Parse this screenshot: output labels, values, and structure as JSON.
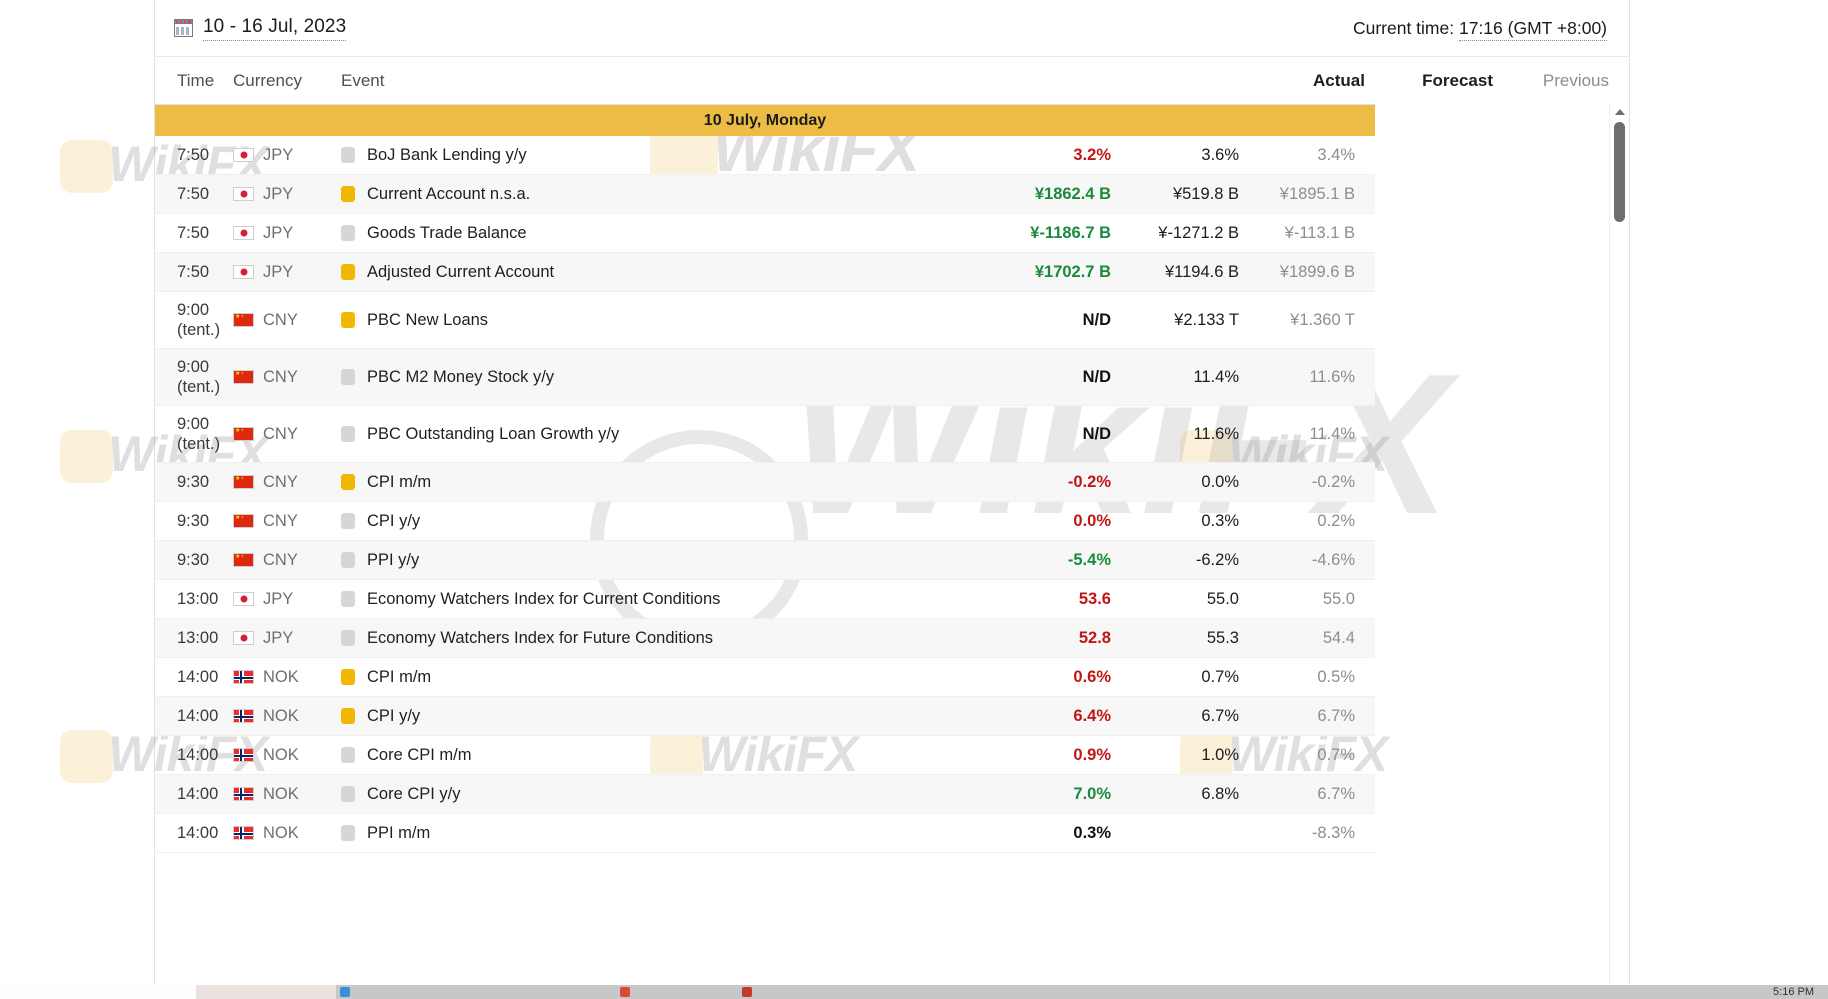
{
  "toolbar": {
    "calendar_icon": "calendar-icon",
    "date_range": "10 - 16 Jul, 2023",
    "current_time_label": "Current time:",
    "current_time_value": "17:16 (GMT +8:00)"
  },
  "columns": {
    "time": "Time",
    "currency": "Currency",
    "event": "Event",
    "actual": "Actual",
    "forecast": "Forecast",
    "previous": "Previous"
  },
  "day_header": "10 July, Monday",
  "rows": [
    {
      "time": "7:50",
      "tentative": "",
      "flag": "jp",
      "currency": "JPY",
      "impact": "low",
      "event": "BoJ Bank Lending y/y",
      "actual": "3.2%",
      "actual_color": "red",
      "forecast": "3.6%",
      "previous": "3.4%"
    },
    {
      "time": "7:50",
      "tentative": "",
      "flag": "jp",
      "currency": "JPY",
      "impact": "med",
      "event": "Current Account n.s.a.",
      "actual": "¥1862.4 B",
      "actual_color": "green",
      "forecast": "¥519.8 B",
      "previous": "¥1895.1 B"
    },
    {
      "time": "7:50",
      "tentative": "",
      "flag": "jp",
      "currency": "JPY",
      "impact": "low",
      "event": "Goods Trade Balance",
      "actual": "¥-1186.7 B",
      "actual_color": "green",
      "forecast": "¥-1271.2 B",
      "previous": "¥-113.1 B"
    },
    {
      "time": "7:50",
      "tentative": "",
      "flag": "jp",
      "currency": "JPY",
      "impact": "med",
      "event": "Adjusted Current Account",
      "actual": "¥1702.7 B",
      "actual_color": "green",
      "forecast": "¥1194.6 B",
      "previous": "¥1899.6 B"
    },
    {
      "time": "9:00",
      "tentative": "(tent.)",
      "flag": "cn",
      "currency": "CNY",
      "impact": "med",
      "event": "PBC New Loans",
      "actual": "N/D",
      "actual_color": "black",
      "forecast": "¥2.133 T",
      "previous": "¥1.360 T"
    },
    {
      "time": "9:00",
      "tentative": "(tent.)",
      "flag": "cn",
      "currency": "CNY",
      "impact": "low",
      "event": "PBC M2 Money Stock y/y",
      "actual": "N/D",
      "actual_color": "black",
      "forecast": "11.4%",
      "previous": "11.6%"
    },
    {
      "time": "9:00",
      "tentative": "(tent.)",
      "flag": "cn",
      "currency": "CNY",
      "impact": "low",
      "event": "PBC Outstanding Loan Growth y/y",
      "actual": "N/D",
      "actual_color": "black",
      "forecast": "11.6%",
      "previous": "11.4%"
    },
    {
      "time": "9:30",
      "tentative": "",
      "flag": "cn",
      "currency": "CNY",
      "impact": "med",
      "event": "CPI m/m",
      "actual": "-0.2%",
      "actual_color": "red",
      "forecast": "0.0%",
      "previous": "-0.2%"
    },
    {
      "time": "9:30",
      "tentative": "",
      "flag": "cn",
      "currency": "CNY",
      "impact": "low",
      "event": "CPI y/y",
      "actual": "0.0%",
      "actual_color": "red",
      "forecast": "0.3%",
      "previous": "0.2%"
    },
    {
      "time": "9:30",
      "tentative": "",
      "flag": "cn",
      "currency": "CNY",
      "impact": "low",
      "event": "PPI y/y",
      "actual": "-5.4%",
      "actual_color": "green",
      "forecast": "-6.2%",
      "previous": "-4.6%"
    },
    {
      "time": "13:00",
      "tentative": "",
      "flag": "jp",
      "currency": "JPY",
      "impact": "low",
      "event": "Economy Watchers Index for Current Conditions",
      "actual": "53.6",
      "actual_color": "red",
      "forecast": "55.0",
      "previous": "55.0"
    },
    {
      "time": "13:00",
      "tentative": "",
      "flag": "jp",
      "currency": "JPY",
      "impact": "low",
      "event": "Economy Watchers Index for Future Conditions",
      "actual": "52.8",
      "actual_color": "red",
      "forecast": "55.3",
      "previous": "54.4"
    },
    {
      "time": "14:00",
      "tentative": "",
      "flag": "no",
      "currency": "NOK",
      "impact": "med",
      "event": "CPI m/m",
      "actual": "0.6%",
      "actual_color": "red",
      "forecast": "0.7%",
      "previous": "0.5%"
    },
    {
      "time": "14:00",
      "tentative": "",
      "flag": "no",
      "currency": "NOK",
      "impact": "med",
      "event": "CPI y/y",
      "actual": "6.4%",
      "actual_color": "red",
      "forecast": "6.7%",
      "previous": "6.7%"
    },
    {
      "time": "14:00",
      "tentative": "",
      "flag": "no",
      "currency": "NOK",
      "impact": "low",
      "event": "Core CPI m/m",
      "actual": "0.9%",
      "actual_color": "red",
      "forecast": "1.0%",
      "previous": "0.7%"
    },
    {
      "time": "14:00",
      "tentative": "",
      "flag": "no",
      "currency": "NOK",
      "impact": "low",
      "event": "Core CPI y/y",
      "actual": "7.0%",
      "actual_color": "green",
      "forecast": "6.8%",
      "previous": "6.7%"
    },
    {
      "time": "14:00",
      "tentative": "",
      "flag": "no",
      "currency": "NOK",
      "impact": "low",
      "event": "PPI m/m",
      "actual": "0.3%",
      "actual_color": "black",
      "forecast": "",
      "previous": "-8.3%"
    }
  ],
  "watermark": {
    "text": "WikiFX"
  },
  "taskbar": {
    "clock": "5:16 PM"
  },
  "colors": {
    "accent_day_bar": "#ecbc45",
    "impact_medium": "#f0b800",
    "impact_low": "#d6d6d6",
    "value_up": "#1a8a3d",
    "value_down": "#bf1616"
  }
}
